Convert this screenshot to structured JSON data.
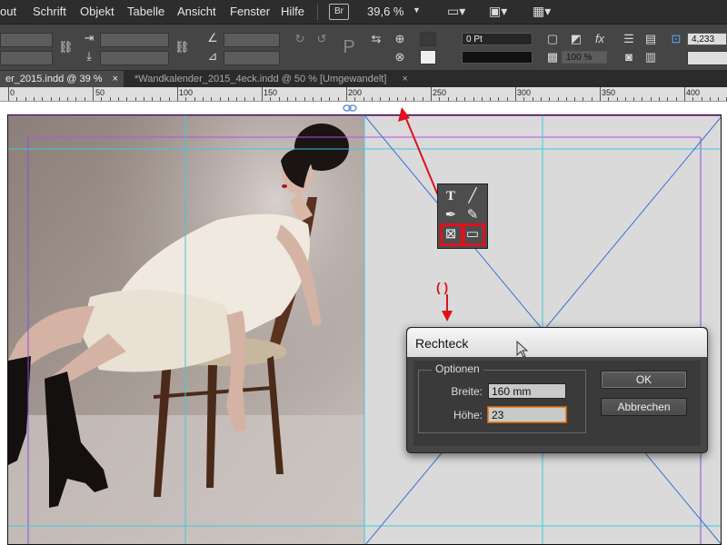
{
  "menubar": {
    "items": [
      "out",
      "Schrift",
      "Objekt",
      "Tabelle",
      "Ansicht",
      "Fenster",
      "Hilfe"
    ],
    "bridge_badge": "Br",
    "zoom": "39,6 %"
  },
  "control": {
    "stroke_weight": "0 Pt",
    "opacity": "100 %",
    "rotate_value": "4,233"
  },
  "tabs": [
    {
      "label": "er_2015.indd @ 39 %",
      "active": true
    },
    {
      "label": "*Wandkalender_2015_4eck.indd @ 50 % [Umgewandelt]",
      "active": false
    }
  ],
  "ruler": {
    "labels": [
      "0",
      "50",
      "100",
      "150",
      "200",
      "250",
      "300",
      "350",
      "400"
    ]
  },
  "annotation": {
    "mark": "( )"
  },
  "dialog": {
    "title": "Rechteck",
    "group_title": "Optionen",
    "width_label": "Breite:",
    "width_value": "160 mm",
    "height_label": "Höhe:",
    "height_value": "23",
    "ok_label": "OK",
    "cancel_label": "Abbrechen"
  },
  "colors": {
    "annotation_red": "#e0101c",
    "guide_cyan": "#3ec9e0",
    "margin_magenta": "#c14ce0",
    "frame_blue": "#3a6fd6"
  }
}
